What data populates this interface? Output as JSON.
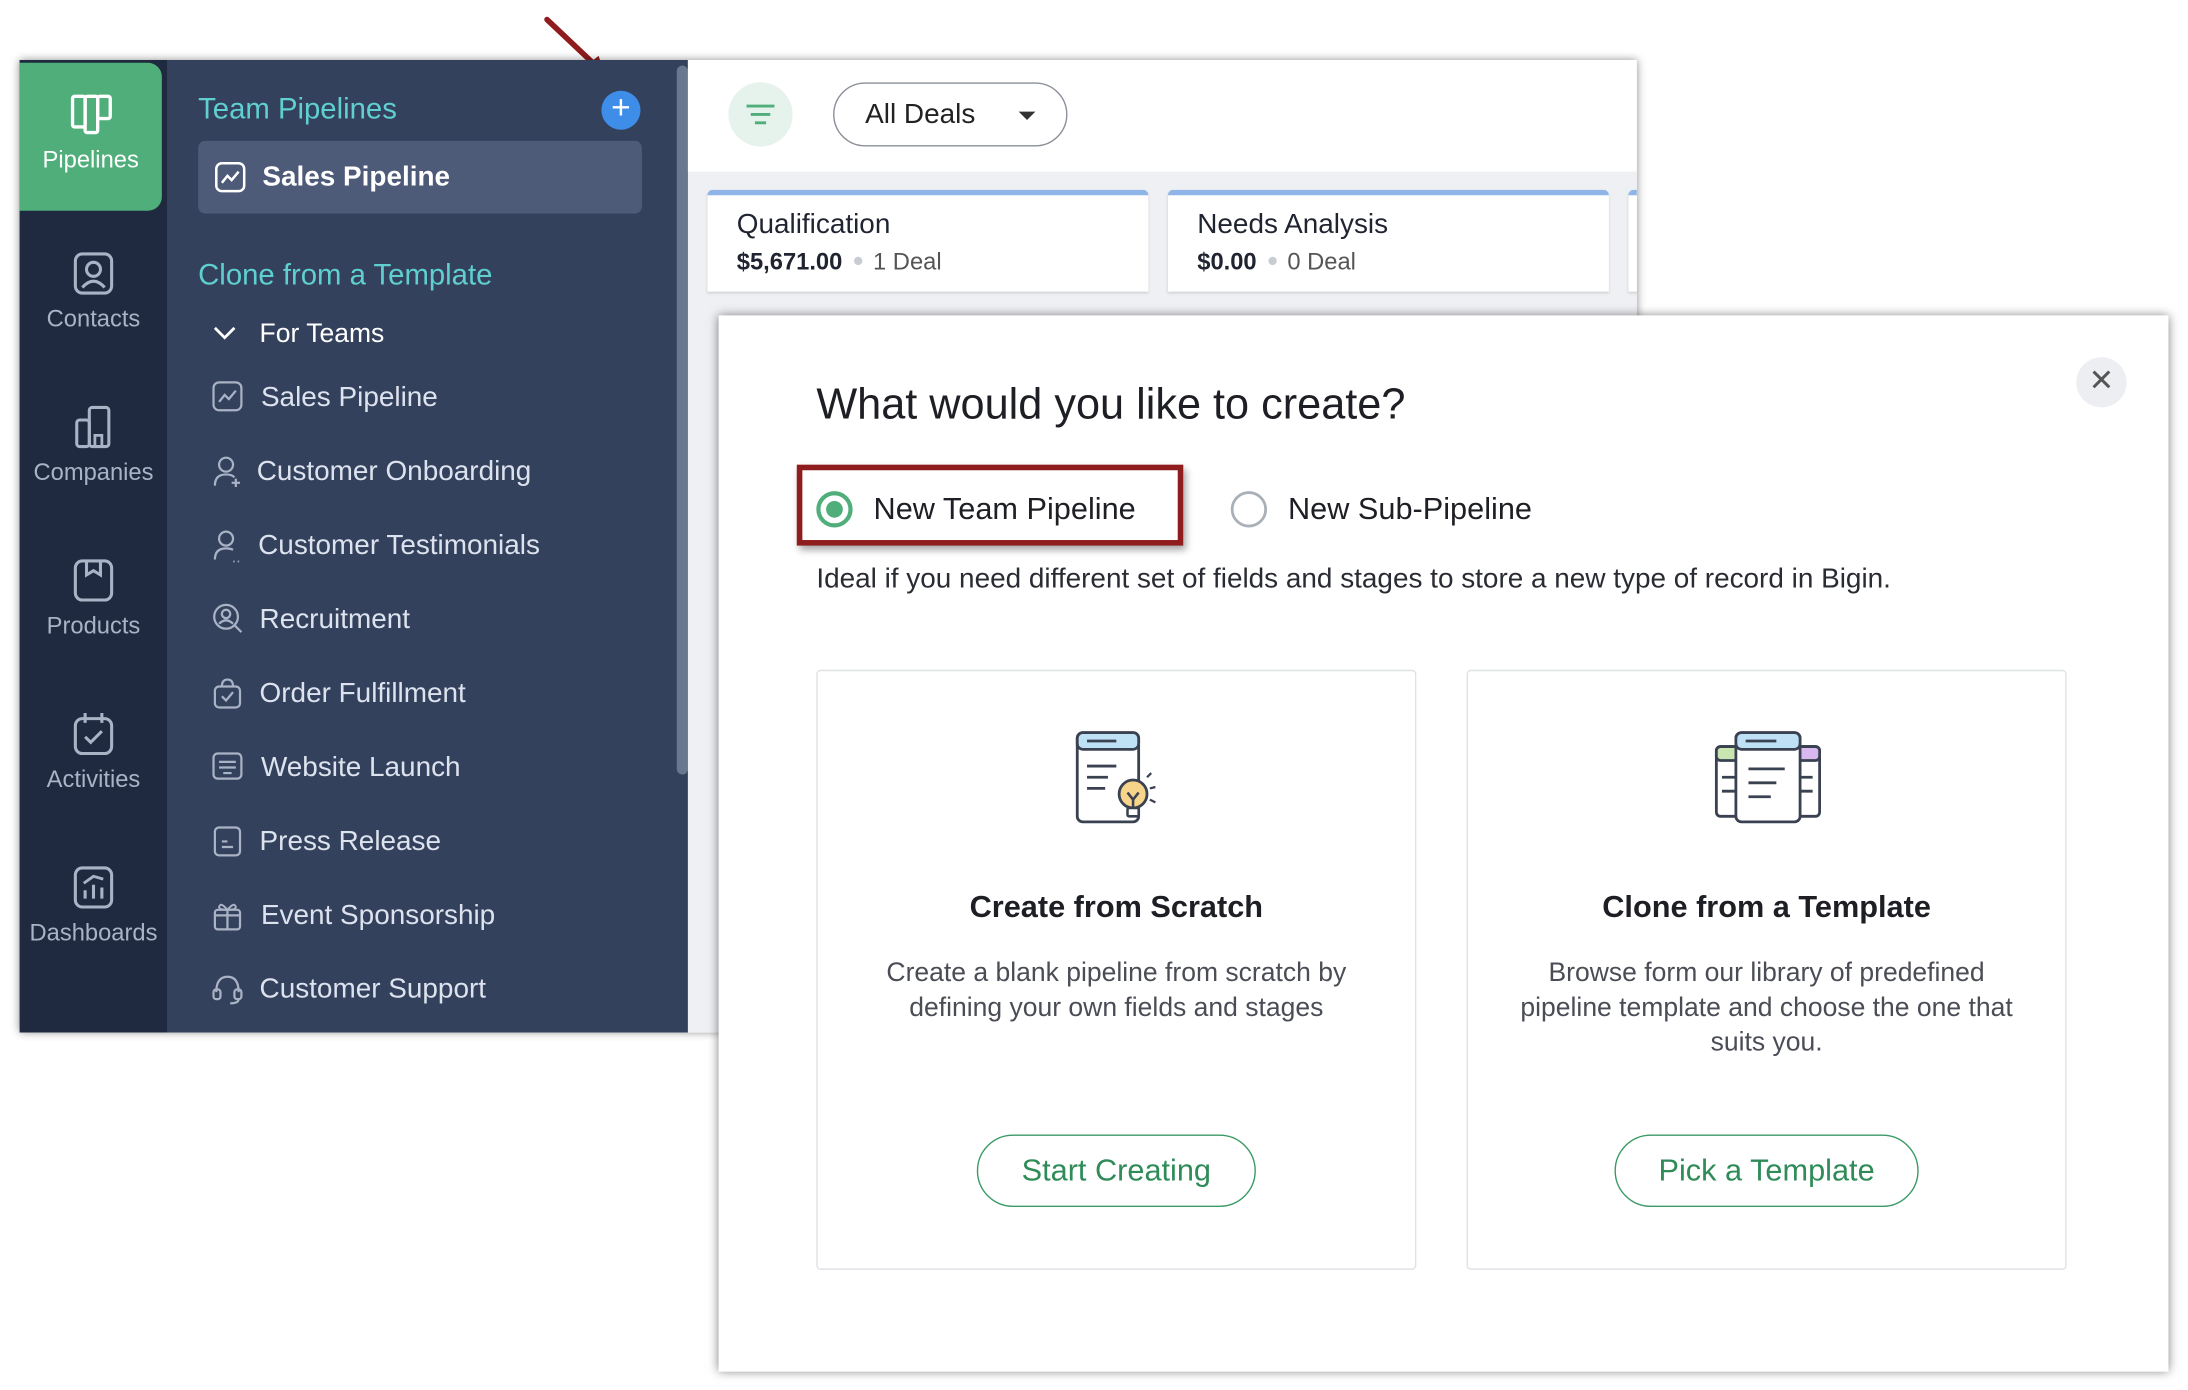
{
  "rail": {
    "items": [
      {
        "label": "Pipelines",
        "icon": "pipelines-icon",
        "active": true
      },
      {
        "label": "Contacts",
        "icon": "contacts-icon"
      },
      {
        "label": "Companies",
        "icon": "companies-icon"
      },
      {
        "label": "Products",
        "icon": "products-icon"
      },
      {
        "label": "Activities",
        "icon": "activities-icon"
      },
      {
        "label": "Dashboards",
        "icon": "dashboards-icon"
      }
    ]
  },
  "sidebar": {
    "team_pipelines_title": "Team Pipelines",
    "add_symbol": "+",
    "selected_pipeline": "Sales Pipeline",
    "clone_title": "Clone from a Template",
    "group_label": "For Teams",
    "templates": [
      {
        "label": "Sales Pipeline",
        "icon": "chart-icon"
      },
      {
        "label": "Customer Onboarding",
        "icon": "user-add-icon"
      },
      {
        "label": "Customer Testimonials",
        "icon": "user-quote-icon"
      },
      {
        "label": "Recruitment",
        "icon": "user-search-icon"
      },
      {
        "label": "Order Fulfillment",
        "icon": "bag-check-icon"
      },
      {
        "label": "Website Launch",
        "icon": "browser-icon"
      },
      {
        "label": "Press Release",
        "icon": "document-icon"
      },
      {
        "label": "Event Sponsorship",
        "icon": "gift-icon"
      },
      {
        "label": "Customer Support",
        "icon": "headset-icon"
      }
    ]
  },
  "topbar": {
    "view_selector": "All Deals"
  },
  "stages": [
    {
      "name": "Qualification",
      "amount": "$5,671.00",
      "count": "1 Deal"
    },
    {
      "name": "Needs Analysis",
      "amount": "$0.00",
      "count": "0 Deal"
    }
  ],
  "modal": {
    "title": "What would you like to create?",
    "close_symbol": "✕",
    "radio_options": [
      {
        "label": "New Team Pipeline",
        "selected": true
      },
      {
        "label": "New Sub-Pipeline",
        "selected": false
      }
    ],
    "description": "Ideal if you need different set of fields and stages to store a new type of record in Bigin.",
    "cards": [
      {
        "title": "Create from Scratch",
        "description": "Create a blank pipeline from scratch by defining your own fields and stages",
        "button": "Start Creating"
      },
      {
        "title": "Clone from a Template",
        "description": "Browse form our library of predefined pipeline template and choose the one that suits you.",
        "button": "Pick a Template"
      }
    ]
  },
  "colors": {
    "accent_green": "#4fae7a",
    "rail_bg": "#1f2a40",
    "sidebar_bg": "#34415d",
    "teal_heading": "#5fcfcf",
    "highlight_box": "#8f1d1d",
    "add_button": "#3e8de8"
  }
}
